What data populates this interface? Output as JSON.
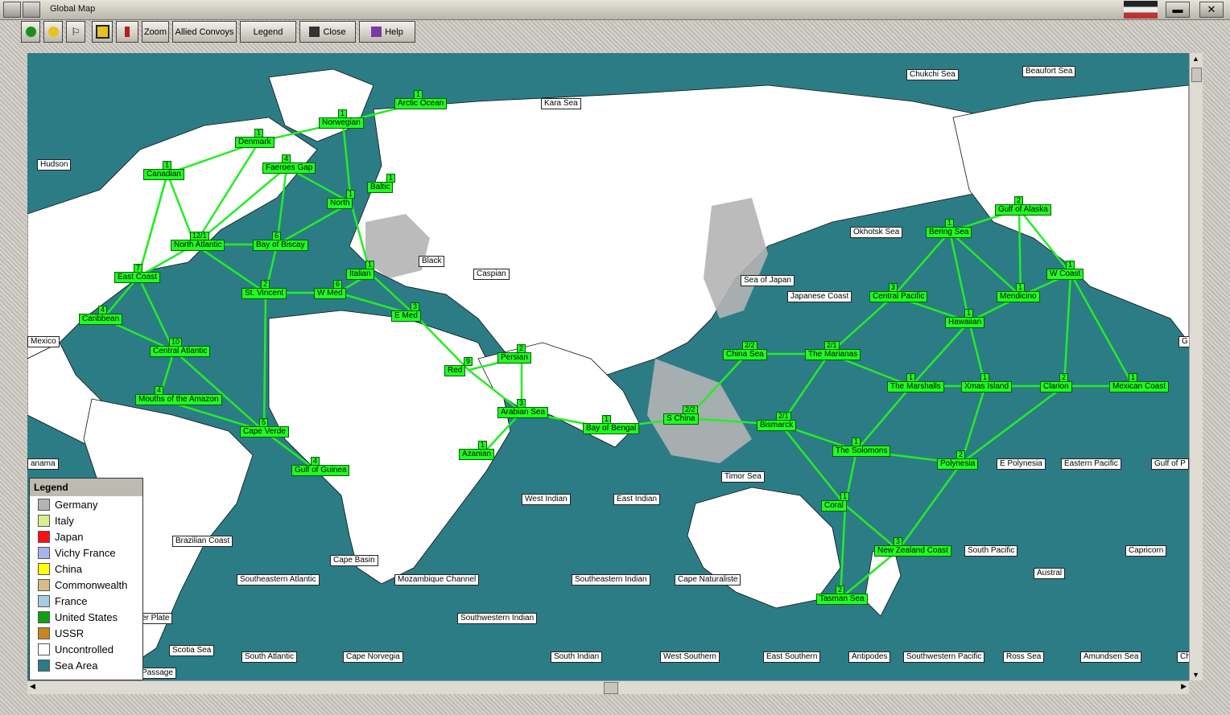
{
  "window": {
    "title": "Global Map"
  },
  "toolbar": {
    "zoom": "Zoom",
    "allied_convoys": "Allied Convoys",
    "legend": "Legend",
    "close": "Close",
    "help": "Help"
  },
  "sea_areas": [
    "Chukchi Sea",
    "Beaufort Sea",
    "Kara Sea",
    "Hudson",
    "Okhotsk Sea",
    "Sea of Japan",
    "Japanese Coast",
    "Black",
    "Caspian",
    "Mexico",
    "Timor Sea",
    "West Indian",
    "East Indian",
    "E Polynesia",
    "Eastern Pacific",
    "Gulf of P",
    "Brazilian Coast",
    "Cape Basin",
    "South Pacific",
    "Capricorn",
    "Austral",
    "Southeastern Atlantic",
    "Mozambique Channel",
    "Southeastern Indian",
    "Cape Naturaliste",
    "Southwestern Indian",
    "er Plate",
    "Scotia Sea",
    "South Atlantic",
    "Cape Norvegia",
    "South Indian",
    "West Southern",
    "East Southern",
    "Antipodes",
    "Southwestern Pacific",
    "Ross Sea",
    "Amundsen Sea",
    "Ch",
    "anama",
    "G",
    "Passage"
  ],
  "zones": [
    {
      "name": "Arctic Ocean",
      "num": "1"
    },
    {
      "name": "Norwegian",
      "num": "1"
    },
    {
      "name": "Denmark",
      "num": "1"
    },
    {
      "name": "Faeroes Gap",
      "num": "4"
    },
    {
      "name": "Canadian",
      "num": "1"
    },
    {
      "name": "Baltic",
      "num": "1"
    },
    {
      "name": "North",
      "num": "1"
    },
    {
      "name": "North Atlantic",
      "num": "12/1"
    },
    {
      "name": "Bay of Biscay",
      "num": "6"
    },
    {
      "name": "East Coast",
      "num": "7"
    },
    {
      "name": "St. Vincent",
      "num": "2"
    },
    {
      "name": "W Med",
      "num": "6"
    },
    {
      "name": "Italian",
      "num": "1"
    },
    {
      "name": "E Med",
      "num": "3"
    },
    {
      "name": "Caribbean",
      "num": "4"
    },
    {
      "name": "Central Atlantic",
      "num": "10"
    },
    {
      "name": "Mouths of the Amazon",
      "num": "4"
    },
    {
      "name": "Cape Verde",
      "num": "5"
    },
    {
      "name": "Gulf of Guinea",
      "num": "4"
    },
    {
      "name": "Red",
      "num": "9"
    },
    {
      "name": "Persian",
      "num": "2"
    },
    {
      "name": "Arabian Sea",
      "num": "3"
    },
    {
      "name": "Azanian",
      "num": "1"
    },
    {
      "name": "Bay of Bengal",
      "num": "1"
    },
    {
      "name": "S China",
      "num": "2/2"
    },
    {
      "name": "China Sea",
      "num": "2/2"
    },
    {
      "name": "Bismarck",
      "num": "2/1"
    },
    {
      "name": "The Marianas",
      "num": "2/1"
    },
    {
      "name": "Central Pacific",
      "num": "3"
    },
    {
      "name": "Bering Sea",
      "num": "1"
    },
    {
      "name": "Gulf of Alaska",
      "num": "2"
    },
    {
      "name": "W Coast",
      "num": "1"
    },
    {
      "name": "Mendicino",
      "num": "1"
    },
    {
      "name": "Hawaiian",
      "num": "1"
    },
    {
      "name": "The Marshalls",
      "num": "1"
    },
    {
      "name": "Xmas Island",
      "num": "1"
    },
    {
      "name": "Clarion",
      "num": "2"
    },
    {
      "name": "Mexican Coast",
      "num": "1"
    },
    {
      "name": "The Solomons",
      "num": "1"
    },
    {
      "name": "Polynesia",
      "num": "2"
    },
    {
      "name": "Coral",
      "num": "1"
    },
    {
      "name": "New Zealand Coast",
      "num": "3"
    },
    {
      "name": "Tasman Sea",
      "num": "2"
    }
  ],
  "legend": {
    "title": "Legend",
    "items": [
      {
        "label": "Germany",
        "color": "#b4b4b4"
      },
      {
        "label": "Italy",
        "color": "#d6f08c"
      },
      {
        "label": "Japan",
        "color": "#ff1010"
      },
      {
        "label": "Vichy France",
        "color": "#a4b4ec"
      },
      {
        "label": "China",
        "color": "#ffff10"
      },
      {
        "label": "Commonwealth",
        "color": "#d4bc8c"
      },
      {
        "label": "France",
        "color": "#a4cce4"
      },
      {
        "label": "United States",
        "color": "#10a010"
      },
      {
        "label": "USSR",
        "color": "#c8861c"
      },
      {
        "label": "Uncontrolled",
        "color": "#ffffff"
      },
      {
        "label": "Sea Area",
        "color": "#2c7c86"
      }
    ]
  },
  "colors": {
    "sea": "#2c7c86",
    "land": "#ffffff",
    "route": "#22ee22",
    "zone_fill": "#1fff1f"
  }
}
